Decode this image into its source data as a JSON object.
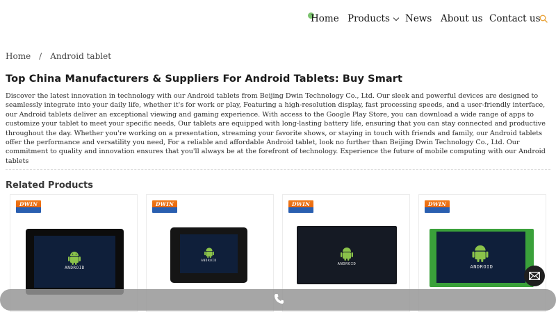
{
  "nav": {
    "home": "Home",
    "products": "Products",
    "news": "News",
    "about": "About us",
    "contact": "Contact us"
  },
  "breadcrumb": {
    "home": "Home",
    "separator": "/",
    "current": "Android tablet"
  },
  "page": {
    "title": "Top China Manufacturers & Suppliers For Android Tablets: Buy Smart",
    "description": "Discover the latest innovation in technology with our Android tablets from Beijing Dwin Technology Co., Ltd. Our sleek and powerful devices are designed to seamlessly integrate into your daily life, whether it's for work or play, Featuring a high-resolution display, fast processing speeds, and a user-friendly interface, our Android tablets deliver an exceptional viewing and gaming experience. With access to the Google Play Store, you can download a wide range of apps to customize your tablet to meet your specific needs, Our tablets are equipped with long-lasting battery life, ensuring that you can stay connected and productive throughout the day. Whether you're working on a presentation, streaming your favorite shows, or staying in touch with friends and family, our Android tablets offer the performance and versatility you need, For a reliable and affordable Android tablet, look no further than Beijing Dwin Technology Co., Ltd. Our commitment to quality and innovation ensures that you'll always be at the forefront of technology. Experience the future of mobile computing with our Android tablets"
  },
  "related": {
    "title": "Related Products",
    "products": [
      {
        "logo_text": "DWIN",
        "screen_text": "ANDROID"
      },
      {
        "logo_text": "DWIN",
        "screen_text": "ANDROID"
      },
      {
        "logo_text": "DWIN",
        "screen_text": "ANDROID"
      },
      {
        "logo_text": "DWIN",
        "screen_text": "ANDROID"
      }
    ]
  },
  "colors": {
    "android_green": "#8bc34a",
    "brand_orange": "#f07a1a",
    "brand_blue": "#2a5fb0",
    "accent_search": "#e8a33a"
  },
  "icons": {
    "search": "search-icon",
    "phone": "phone-icon",
    "mail": "mail-icon",
    "chevron": "chevron-down-icon"
  }
}
